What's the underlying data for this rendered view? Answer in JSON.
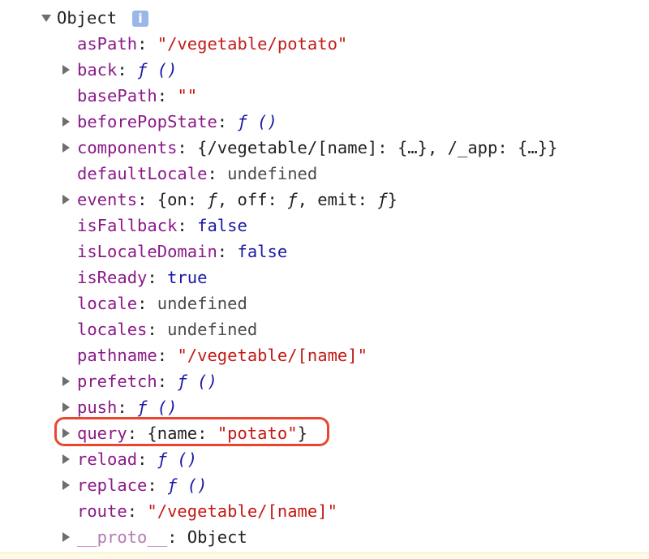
{
  "root": {
    "label": "Object",
    "info_icon": "i"
  },
  "properties": [
    {
      "key": "asPath",
      "sep": ": ",
      "value": "\"/vegetable/potato\"",
      "type": "string",
      "expandable": false
    },
    {
      "key": "back",
      "sep": ": ",
      "value": "ƒ ()",
      "type": "function",
      "expandable": true
    },
    {
      "key": "basePath",
      "sep": ": ",
      "value": "\"\"",
      "type": "string",
      "expandable": false
    },
    {
      "key": "beforePopState",
      "sep": ": ",
      "value": "ƒ ()",
      "type": "function",
      "expandable": true
    },
    {
      "key": "components",
      "sep": ": ",
      "value_parts": [
        "{/vegetable/[name]: {…}, /_app: {…}}"
      ],
      "type": "object",
      "expandable": true
    },
    {
      "key": "defaultLocale",
      "sep": ": ",
      "value": "undefined",
      "type": "undefined",
      "expandable": false
    },
    {
      "key": "events",
      "sep": ": ",
      "value_parts": [
        "{on: ",
        "ƒ",
        ", off: ",
        "ƒ",
        ", emit: ",
        "ƒ",
        "}"
      ],
      "type": "object",
      "expandable": true
    },
    {
      "key": "isFallback",
      "sep": ": ",
      "value": "false",
      "type": "boolean",
      "expandable": false
    },
    {
      "key": "isLocaleDomain",
      "sep": ": ",
      "value": "false",
      "type": "boolean",
      "expandable": false
    },
    {
      "key": "isReady",
      "sep": ": ",
      "value": "true",
      "type": "boolean",
      "expandable": false
    },
    {
      "key": "locale",
      "sep": ": ",
      "value": "undefined",
      "type": "undefined",
      "expandable": false
    },
    {
      "key": "locales",
      "sep": ": ",
      "value": "undefined",
      "type": "undefined",
      "expandable": false
    },
    {
      "key": "pathname",
      "sep": ": ",
      "value": "\"/vegetable/[name]\"",
      "type": "string",
      "expandable": false
    },
    {
      "key": "prefetch",
      "sep": ": ",
      "value": "ƒ ()",
      "type": "function",
      "expandable": true
    },
    {
      "key": "push",
      "sep": ": ",
      "value": "ƒ ()",
      "type": "function",
      "expandable": true
    },
    {
      "key": "query",
      "sep": ": ",
      "value_parts": [
        "{name: ",
        "\"potato\"",
        "}"
      ],
      "type": "object",
      "expandable": true,
      "highlighted": true
    },
    {
      "key": "reload",
      "sep": ": ",
      "value": "ƒ ()",
      "type": "function",
      "expandable": true
    },
    {
      "key": "replace",
      "sep": ": ",
      "value": "ƒ ()",
      "type": "function",
      "expandable": true
    },
    {
      "key": "route",
      "sep": ": ",
      "value": "\"/vegetable/[name]\"",
      "type": "string",
      "expandable": false
    },
    {
      "key": "__proto__",
      "sep": ": ",
      "value": "Object",
      "type": "proto",
      "expandable": true
    }
  ],
  "colors": {
    "key": "#8b1a89",
    "string": "#c41a16",
    "boolean": "#1a1aa6",
    "highlight": "#e8472f"
  }
}
